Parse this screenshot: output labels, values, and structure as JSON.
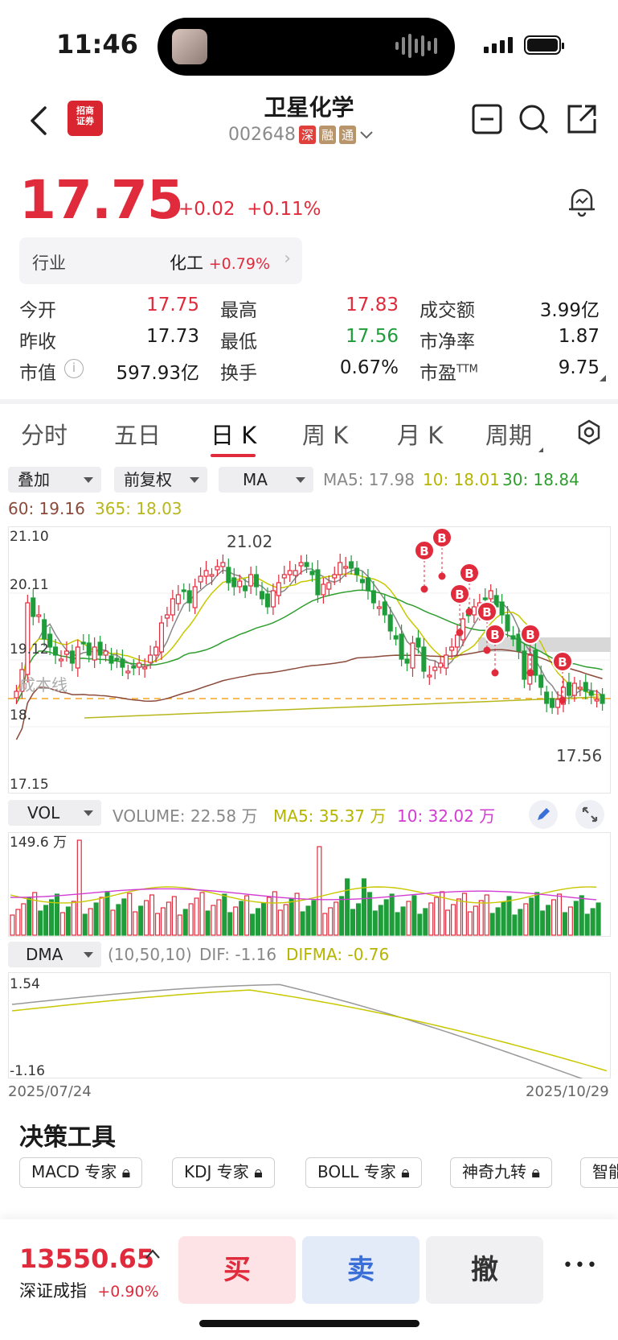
{
  "status": {
    "time": "11:46"
  },
  "header": {
    "title": "卫星化学",
    "code": "002648",
    "tags": [
      "深",
      "融",
      "通"
    ]
  },
  "quote": {
    "price": "17.75",
    "change": "+0.02",
    "change_pct": "+0.11%"
  },
  "industry": {
    "label": "行业",
    "name": "化工",
    "pct": "+0.79%"
  },
  "stats": {
    "open_label": "今开",
    "open": "17.75",
    "high_label": "最高",
    "high": "17.83",
    "amount_label": "成交额",
    "amount": "3.99亿",
    "prev_label": "昨收",
    "prev": "17.73",
    "low_label": "最低",
    "low": "17.56",
    "pb_label": "市净率",
    "pb": "1.87",
    "mcap_label": "市值",
    "mcap": "597.93亿",
    "turn_label": "换手",
    "turn": "0.67%",
    "pe_label": "市盈",
    "pe_sup": "TTM",
    "pe": "9.75"
  },
  "tabs": [
    "分时",
    "五日",
    "日 K",
    "周 K",
    "月 K",
    "周期"
  ],
  "controls": {
    "overlay": "叠加",
    "adjust": "前复权",
    "indicator": "MA"
  },
  "ma_legend": {
    "ma5": "MA5: 17.98",
    "ma10": "10: 18.01",
    "ma30": "30: 18.84",
    "ma60": "60: 19.16",
    "ma365": "365: 18.03"
  },
  "kline": {
    "y_labels": [
      "21.10",
      "20.11",
      "19.12",
      "18.",
      "17.15"
    ],
    "high_marker": "21.02",
    "low_marker": "17.56",
    "cost_line_label": "成本线",
    "buy_marker": "B"
  },
  "volume": {
    "select": "VOL",
    "label": "VOLUME: 22.58 万",
    "ma5": "MA5: 35.37 万",
    "ma10": "10: 32.02 万",
    "y_max": "149.6 万"
  },
  "dma": {
    "select": "DMA",
    "params": "(10,50,10)",
    "dif": "DIF: -1.16",
    "difma": "DIFMA: -0.76",
    "y_top": "1.54",
    "y_bottom": "-1.16"
  },
  "dates": {
    "start": "2025/07/24",
    "end": "2025/10/29"
  },
  "tools": {
    "title": "决策工具",
    "items": [
      "MACD 专家",
      "KDJ 专家",
      "BOLL 专家",
      "神奇九转",
      "智能"
    ]
  },
  "bottom_bar": {
    "index_value": "13550.65",
    "index_name": "深证成指",
    "index_pct": "+0.90%",
    "buy": "买",
    "sell": "卖",
    "cancel": "撤",
    "more": "•••"
  },
  "colors": {
    "up": "#e02b3c",
    "down": "#1f9d3a",
    "ma5": "#888888",
    "ma10": "#c8c800",
    "ma30": "#2f9e2f",
    "ma60": "#8b4a3a",
    "ma365": "#b7b71c"
  }
}
